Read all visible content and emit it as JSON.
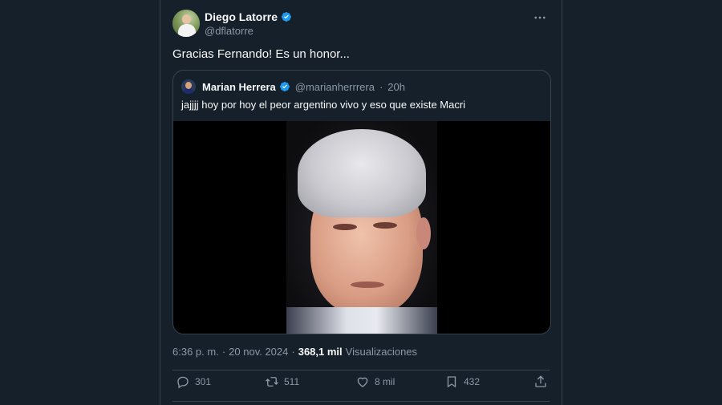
{
  "tweet": {
    "author_name": "Diego Latorre",
    "author_handle": "@dflatorre",
    "text": "Gracias Fernando! Es un honor...",
    "more_icon": "more-horizontal-icon"
  },
  "quoted": {
    "author_name": "Marian Herrera",
    "author_handle": "@marianherrrera",
    "separator": "·",
    "time": "20h",
    "text": "jajjjj hoy por hoy el peor argentino vivo y eso que existe Macri"
  },
  "meta": {
    "time": "6:36 p. m.",
    "separator": "·",
    "date": "20 nov. 2024",
    "separator2": "·",
    "views_count": "368,1 mil",
    "views_label": "Visualizaciones"
  },
  "actions": {
    "replies": "301",
    "retweets": "511",
    "likes": "8 mil",
    "bookmarks": "432"
  },
  "colors": {
    "background": "#15202b",
    "border": "#38444d",
    "text": "#f7f9f9",
    "muted": "#8b98a5",
    "verified": "#1d9bf0"
  }
}
